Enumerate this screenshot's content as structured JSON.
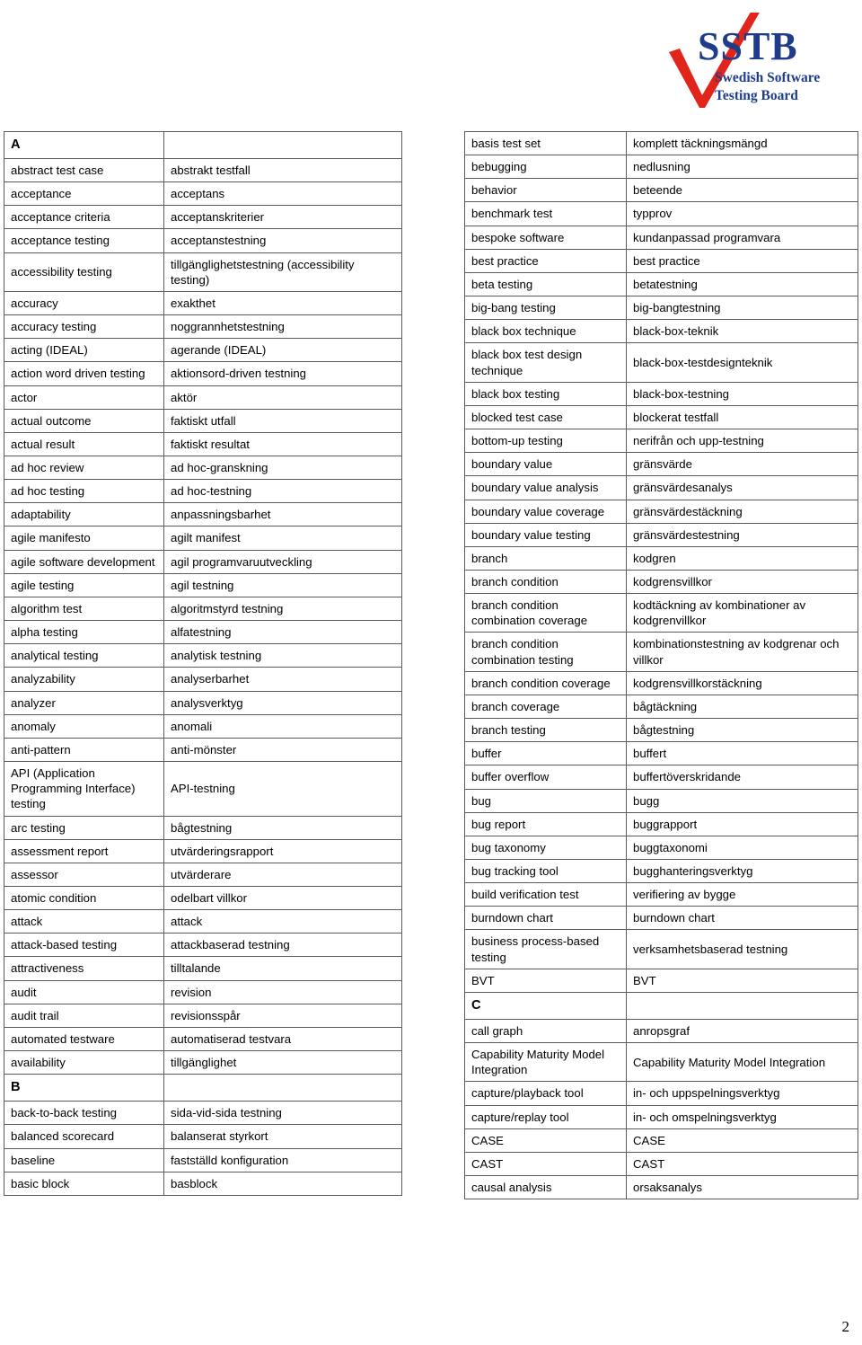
{
  "document": {
    "page_number": "2",
    "logo": {
      "acronym": "SSTB",
      "line1": "Swedish Software",
      "line2": "Testing Board",
      "acronym_color": "#1F3C8B",
      "check_color": "#E1251B",
      "subtitle_color": "#1F3C8B",
      "checkmark_icon": "red-checkmark-icon"
    }
  },
  "table_columns": [
    {
      "id": "left",
      "rows": [
        {
          "type": "letter",
          "term": "A",
          "translation": ""
        },
        {
          "type": "entry",
          "term": "abstract test case",
          "translation": "abstrakt testfall"
        },
        {
          "type": "entry",
          "term": "acceptance",
          "translation": "acceptans"
        },
        {
          "type": "entry",
          "term": "acceptance criteria",
          "translation": "acceptanskriterier"
        },
        {
          "type": "entry",
          "term": "acceptance testing",
          "translation": "acceptanstestning"
        },
        {
          "type": "entry",
          "term": "accessibility testing",
          "translation": "tillgänglighetstestning (accessibility testing)"
        },
        {
          "type": "entry",
          "term": "accuracy",
          "translation": "exakthet"
        },
        {
          "type": "entry",
          "term": "accuracy testing",
          "translation": "noggrannhetstestning"
        },
        {
          "type": "entry",
          "term": "acting (IDEAL)",
          "translation": "agerande (IDEAL)"
        },
        {
          "type": "entry",
          "term": "action word driven testing",
          "translation": "aktionsord-driven testning"
        },
        {
          "type": "entry",
          "term": "actor",
          "translation": "aktör"
        },
        {
          "type": "entry",
          "term": "actual outcome",
          "translation": "faktiskt utfall"
        },
        {
          "type": "entry",
          "term": "actual result",
          "translation": "faktiskt resultat"
        },
        {
          "type": "entry",
          "term": "ad hoc review",
          "translation": "ad hoc-granskning"
        },
        {
          "type": "entry",
          "term": "ad hoc testing",
          "translation": "ad hoc-testning"
        },
        {
          "type": "entry",
          "term": "adaptability",
          "translation": "anpassningsbarhet"
        },
        {
          "type": "entry",
          "term": "agile manifesto",
          "translation": "agilt manifest"
        },
        {
          "type": "entry",
          "term": "agile software development",
          "translation": "agil programvaruutveckling"
        },
        {
          "type": "entry",
          "term": "agile testing",
          "translation": "agil testning"
        },
        {
          "type": "entry",
          "term": "algorithm test",
          "translation": "algoritmstyrd testning"
        },
        {
          "type": "entry",
          "term": "alpha testing",
          "translation": "alfatestning"
        },
        {
          "type": "entry",
          "term": "analytical testing",
          "translation": "analytisk testning"
        },
        {
          "type": "entry",
          "term": "analyzability",
          "translation": "analyserbarhet"
        },
        {
          "type": "entry",
          "term": "analyzer",
          "translation": "analysverktyg"
        },
        {
          "type": "entry",
          "term": "anomaly",
          "translation": "anomali"
        },
        {
          "type": "entry",
          "term": "anti-pattern",
          "translation": "anti-mönster"
        },
        {
          "type": "entry",
          "term": "API (Application Programming Interface) testing",
          "translation": "API-testning"
        },
        {
          "type": "entry",
          "term": "arc testing",
          "translation": "bågtestning"
        },
        {
          "type": "entry",
          "term": "assessment report",
          "translation": "utvärderingsrapport"
        },
        {
          "type": "entry",
          "term": "assessor",
          "translation": "utvärderare"
        },
        {
          "type": "entry",
          "term": "atomic condition",
          "translation": "odelbart villkor"
        },
        {
          "type": "entry",
          "term": "attack",
          "translation": "attack"
        },
        {
          "type": "entry",
          "term": "attack-based testing",
          "translation": "attackbaserad testning"
        },
        {
          "type": "entry",
          "term": "attractiveness",
          "translation": "tilltalande"
        },
        {
          "type": "entry",
          "term": "audit",
          "translation": "revision"
        },
        {
          "type": "entry",
          "term": "audit trail",
          "translation": "revisionsspår"
        },
        {
          "type": "entry",
          "term": "automated testware",
          "translation": "automatiserad testvara"
        },
        {
          "type": "entry",
          "term": "availability",
          "translation": "tillgänglighet"
        },
        {
          "type": "letter",
          "term": "B",
          "translation": ""
        },
        {
          "type": "entry",
          "term": "back-to-back testing",
          "translation": "sida-vid-sida testning"
        },
        {
          "type": "entry",
          "term": "balanced scorecard",
          "translation": "balanserat styrkort"
        },
        {
          "type": "entry",
          "term": "baseline",
          "translation": "fastställd konfiguration"
        },
        {
          "type": "entry",
          "term": "basic block",
          "translation": "basblock"
        }
      ]
    },
    {
      "id": "right",
      "rows": [
        {
          "type": "entry",
          "term": "basis test set",
          "translation": "komplett täckningsmängd"
        },
        {
          "type": "entry",
          "term": "bebugging",
          "translation": "nedlusning"
        },
        {
          "type": "entry",
          "term": "behavior",
          "translation": "beteende"
        },
        {
          "type": "entry",
          "term": "benchmark test",
          "translation": "typprov"
        },
        {
          "type": "entry",
          "term": "bespoke software",
          "translation": "kundanpassad programvara"
        },
        {
          "type": "entry",
          "term": "best practice",
          "translation": "best practice"
        },
        {
          "type": "entry",
          "term": "beta testing",
          "translation": "betatestning"
        },
        {
          "type": "entry",
          "term": "big-bang testing",
          "translation": "big-bangtestning"
        },
        {
          "type": "entry",
          "term": "black box technique",
          "translation": "black-box-teknik"
        },
        {
          "type": "entry",
          "term": "black box test design technique",
          "translation": "black-box-testdesignteknik"
        },
        {
          "type": "entry",
          "term": "black box testing",
          "translation": "black-box-testning"
        },
        {
          "type": "entry",
          "term": "blocked test case",
          "translation": "blockerat testfall"
        },
        {
          "type": "entry",
          "term": "bottom-up testing",
          "translation": "nerifrån och upp-testning"
        },
        {
          "type": "entry",
          "term": "boundary value",
          "translation": "gränsvärde"
        },
        {
          "type": "entry",
          "term": "boundary value analysis",
          "translation": "gränsvärdesanalys"
        },
        {
          "type": "entry",
          "term": "boundary value coverage",
          "translation": "gränsvärdestäckning"
        },
        {
          "type": "entry",
          "term": "boundary value testing",
          "translation": "gränsvärdestestning"
        },
        {
          "type": "entry",
          "term": "branch",
          "translation": "kodgren"
        },
        {
          "type": "entry",
          "term": "branch condition",
          "translation": "kodgrensvillkor"
        },
        {
          "type": "entry",
          "term": "branch condition combination coverage",
          "translation": "kodtäckning av kombinationer av kodgrenvillkor"
        },
        {
          "type": "entry",
          "term": "branch condition combination testing",
          "translation": "kombinationstestning av kodgrenar och villkor"
        },
        {
          "type": "entry",
          "term": "branch condition coverage",
          "translation": "kodgrensvillkorstäckning"
        },
        {
          "type": "entry",
          "term": "branch coverage",
          "translation": "bågtäckning"
        },
        {
          "type": "entry",
          "term": "branch testing",
          "translation": "bågtestning"
        },
        {
          "type": "entry",
          "term": "buffer",
          "translation": "buffert"
        },
        {
          "type": "entry",
          "term": "buffer overflow",
          "translation": "buffertöverskridande"
        },
        {
          "type": "entry",
          "term": "bug",
          "translation": "bugg"
        },
        {
          "type": "entry",
          "term": "bug report",
          "translation": "buggrapport"
        },
        {
          "type": "entry",
          "term": "bug taxonomy",
          "translation": "buggtaxonomi"
        },
        {
          "type": "entry",
          "term": "bug tracking tool",
          "translation": "bugghanteringsverktyg"
        },
        {
          "type": "entry",
          "term": "build verification test",
          "translation": "verifiering av bygge"
        },
        {
          "type": "entry",
          "term": "burndown chart",
          "translation": "burndown chart"
        },
        {
          "type": "entry",
          "term": "business process-based testing",
          "translation": "verksamhetsbaserad testning"
        },
        {
          "type": "entry",
          "term": "BVT",
          "translation": "BVT"
        },
        {
          "type": "letter",
          "term": "C",
          "translation": ""
        },
        {
          "type": "entry",
          "term": "call graph",
          "translation": "anropsgraf"
        },
        {
          "type": "entry",
          "term": "Capability Maturity Model Integration",
          "translation": "Capability Maturity Model Integration"
        },
        {
          "type": "entry",
          "term": "capture/playback tool",
          "translation": "in- och uppspelningsverktyg"
        },
        {
          "type": "entry",
          "term": "capture/replay tool",
          "translation": "in- och omspelningsverktyg"
        },
        {
          "type": "entry",
          "term": "CASE",
          "translation": "CASE"
        },
        {
          "type": "entry",
          "term": "CAST",
          "translation": "CAST"
        },
        {
          "type": "entry",
          "term": "causal analysis",
          "translation": "orsaksanalys"
        }
      ]
    }
  ]
}
